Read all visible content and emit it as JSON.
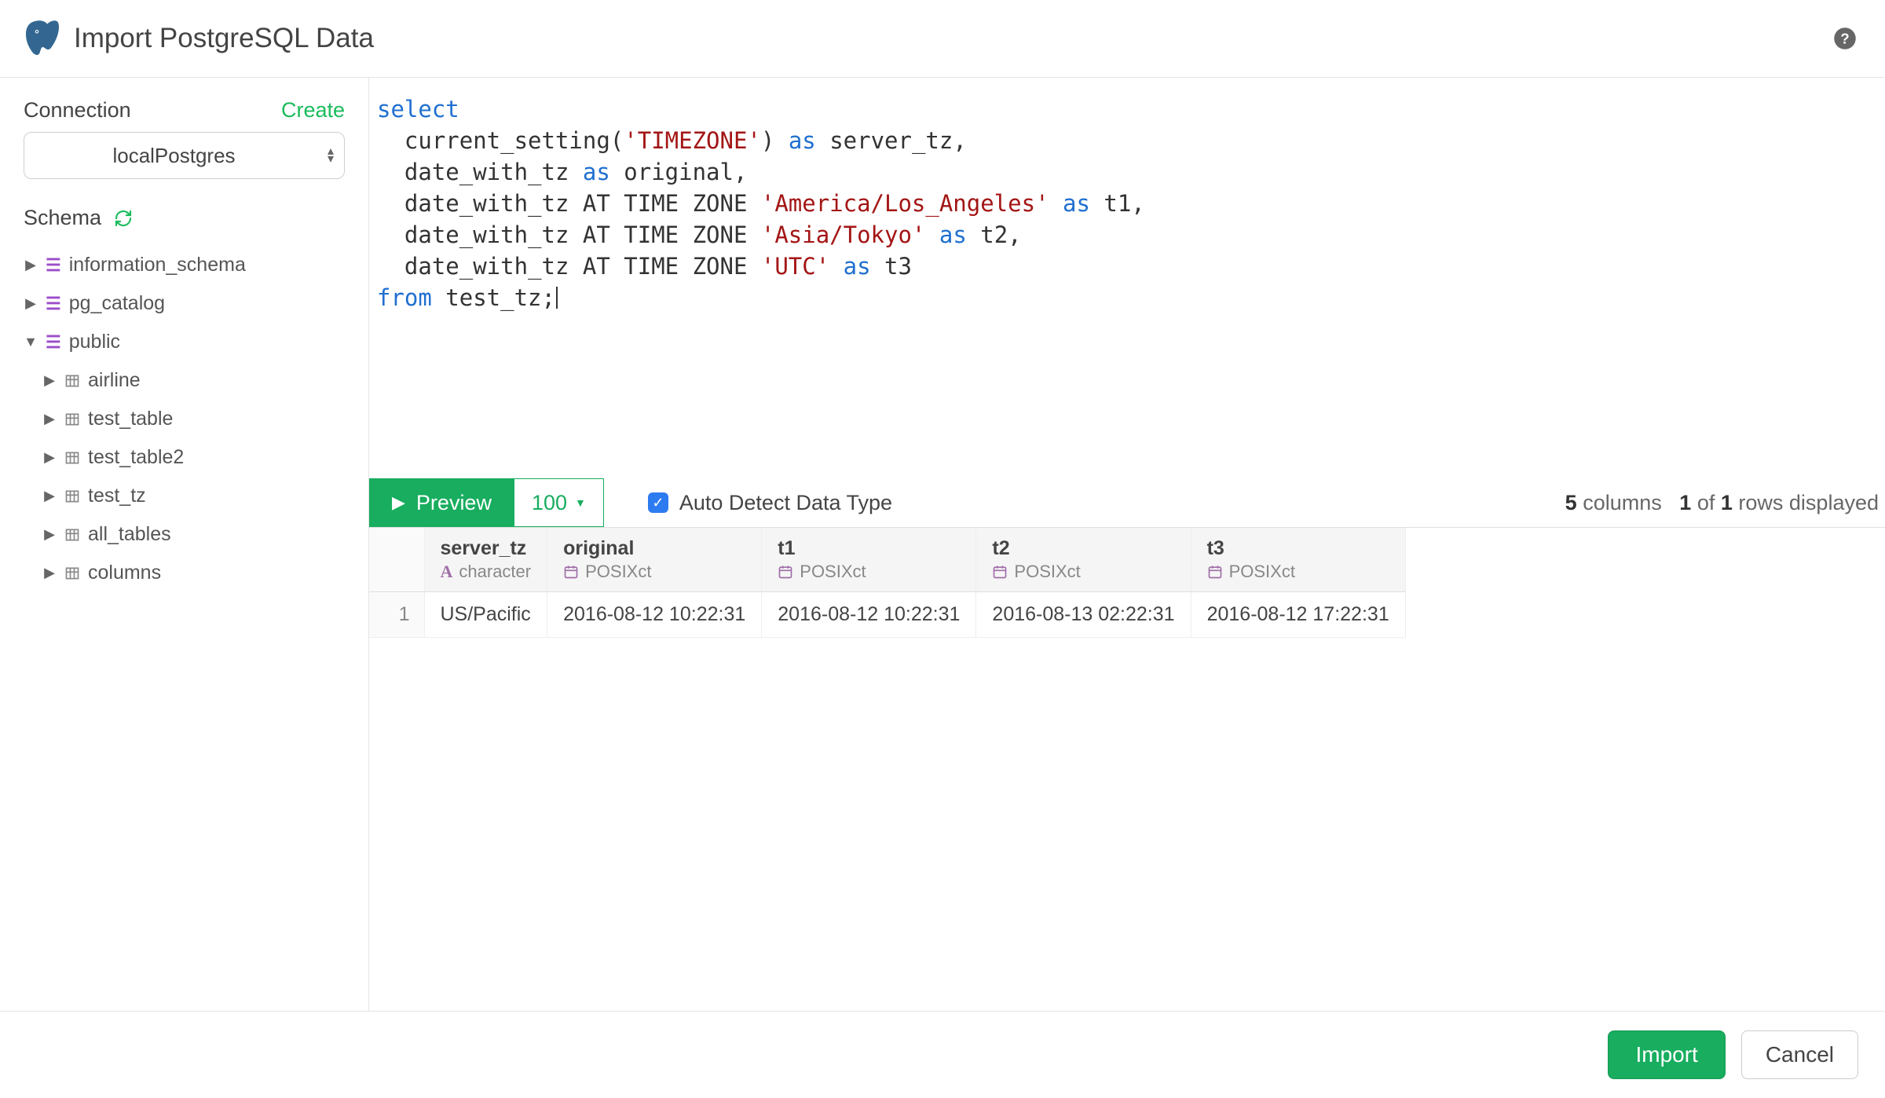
{
  "header": {
    "title": "Import PostgreSQL Data"
  },
  "sidebar": {
    "connection_label": "Connection",
    "create_label": "Create",
    "connection_value": "localPostgres",
    "schema_label": "Schema",
    "schemas": [
      {
        "name": "information_schema",
        "expanded": false
      },
      {
        "name": "pg_catalog",
        "expanded": false
      },
      {
        "name": "public",
        "expanded": true,
        "tables": [
          {
            "name": "airline"
          },
          {
            "name": "test_table"
          },
          {
            "name": "test_table2"
          },
          {
            "name": "test_tz"
          },
          {
            "name": "all_tables"
          },
          {
            "name": "columns"
          }
        ]
      }
    ]
  },
  "sql": {
    "tokens": [
      {
        "t": "kw",
        "v": "select"
      },
      {
        "t": "nl"
      },
      {
        "t": "sp",
        "v": "  "
      },
      {
        "t": "id",
        "v": "current_setting("
      },
      {
        "t": "str",
        "v": "'TIMEZONE'"
      },
      {
        "t": "id",
        "v": ") "
      },
      {
        "t": "kw",
        "v": "as"
      },
      {
        "t": "id",
        "v": " server_tz,"
      },
      {
        "t": "nl"
      },
      {
        "t": "sp",
        "v": "  "
      },
      {
        "t": "id",
        "v": "date_with_tz "
      },
      {
        "t": "kw",
        "v": "as"
      },
      {
        "t": "id",
        "v": " original,"
      },
      {
        "t": "nl"
      },
      {
        "t": "sp",
        "v": "  "
      },
      {
        "t": "id",
        "v": "date_with_tz AT TIME ZONE "
      },
      {
        "t": "str",
        "v": "'America/Los_Angeles'"
      },
      {
        "t": "id",
        "v": " "
      },
      {
        "t": "kw",
        "v": "as"
      },
      {
        "t": "id",
        "v": " t1,"
      },
      {
        "t": "nl"
      },
      {
        "t": "sp",
        "v": "  "
      },
      {
        "t": "id",
        "v": "date_with_tz AT TIME ZONE "
      },
      {
        "t": "str",
        "v": "'Asia/Tokyo'"
      },
      {
        "t": "id",
        "v": " "
      },
      {
        "t": "kw",
        "v": "as"
      },
      {
        "t": "id",
        "v": " t2,"
      },
      {
        "t": "nl"
      },
      {
        "t": "sp",
        "v": "  "
      },
      {
        "t": "id",
        "v": "date_with_tz AT TIME ZONE "
      },
      {
        "t": "str",
        "v": "'UTC'"
      },
      {
        "t": "id",
        "v": " "
      },
      {
        "t": "kw",
        "v": "as"
      },
      {
        "t": "id",
        "v": " t3"
      },
      {
        "t": "nl"
      },
      {
        "t": "kw",
        "v": "from"
      },
      {
        "t": "id",
        "v": " test_tz;"
      },
      {
        "t": "cursor"
      }
    ]
  },
  "toolbar": {
    "preview_label": "Preview",
    "limit_label": "100",
    "auto_detect_label": "Auto Detect Data Type",
    "auto_detect_checked": true
  },
  "stats": {
    "columns": "5",
    "columns_word": "columns",
    "rows_shown": "1",
    "of_word": "of",
    "rows_total": "1",
    "rows_suffix": "rows displayed"
  },
  "results": {
    "columns": [
      {
        "name": "server_tz",
        "type": "character",
        "type_icon": "A"
      },
      {
        "name": "original",
        "type": "POSIXct",
        "type_icon": "cal"
      },
      {
        "name": "t1",
        "type": "POSIXct",
        "type_icon": "cal"
      },
      {
        "name": "t2",
        "type": "POSIXct",
        "type_icon": "cal"
      },
      {
        "name": "t3",
        "type": "POSIXct",
        "type_icon": "cal"
      }
    ],
    "rows": [
      {
        "n": "1",
        "cells": [
          "US/Pacific",
          "2016-08-12 10:22:31",
          "2016-08-12 10:22:31",
          "2016-08-13 02:22:31",
          "2016-08-12 17:22:31"
        ]
      }
    ]
  },
  "footer": {
    "import_label": "Import",
    "cancel_label": "Cancel"
  }
}
